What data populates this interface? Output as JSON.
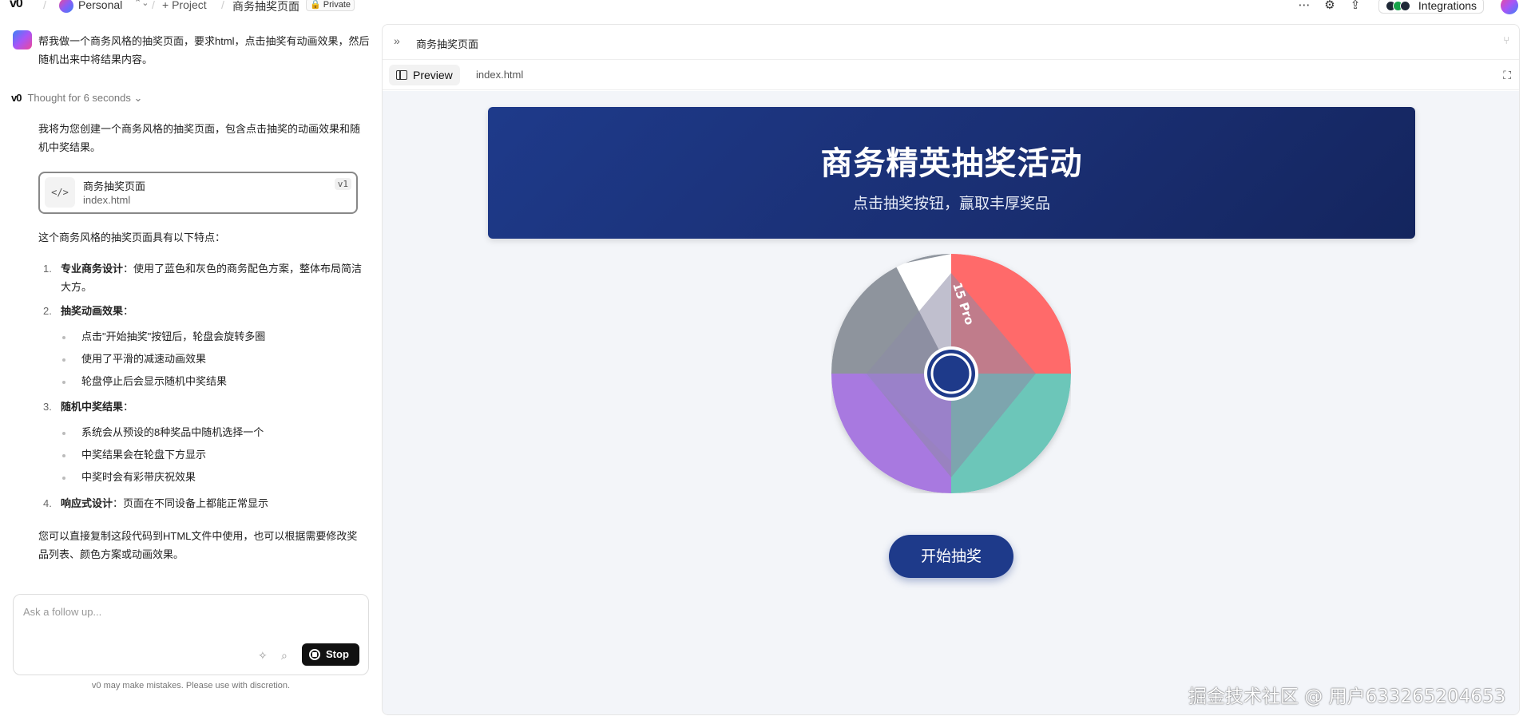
{
  "topbar": {
    "logo": "v0",
    "workspace": "Personal",
    "project_btn": "+ Project",
    "chat_title": "商务抽奖页面",
    "private_label": "Private",
    "integrations_label": "Integrations"
  },
  "chat": {
    "user_message": "帮我做一个商务风格的抽奖页面，要求html，点击抽奖有动画效果，然后随机出来中将结果内容。",
    "thought_label": "Thought for 6 seconds",
    "intro": "我将为您创建一个商务风格的抽奖页面，包含点击抽奖的动画效果和随机中奖结果。",
    "code_card": {
      "title": "商务抽奖页面",
      "file": "index.html",
      "version": "v1"
    },
    "features_intro": "这个商务风格的抽奖页面具有以下特点：",
    "features": [
      {
        "num": "1.",
        "title": "专业商务设计",
        "desc": "：使用了蓝色和灰色的商务配色方案，整体布局简洁大方。"
      },
      {
        "num": "2.",
        "title": "抽奖动画效果",
        "desc": "："
      },
      {
        "num": "3.",
        "title": "随机中奖结果",
        "desc": "："
      },
      {
        "num": "4.",
        "title": "响应式设计",
        "desc": "：页面在不同设备上都能正常显示"
      }
    ],
    "bullets_2": [
      "点击\"开始抽奖\"按钮后，轮盘会旋转多圈",
      "使用了平滑的减速动画效果",
      "轮盘停止后会显示随机中奖结果"
    ],
    "bullets_3": [
      "系统会从预设的8种奖品中随机选择一个",
      "中奖结果会在轮盘下方显示",
      "中奖时会有彩带庆祝效果"
    ],
    "closing": "您可以直接复制这段代码到HTML文件中使用，也可以根据需要修改奖品列表、颜色方案或动画效果。",
    "followup_placeholder": "Ask a follow up...",
    "stop_label": "Stop",
    "disclaimer": "v0 may make mistakes. Please use with discretion."
  },
  "preview": {
    "header_title": "商务抽奖页面",
    "tab_preview": "Preview",
    "tab_file": "index.html",
    "banner_title": "商务精英抽奖活动",
    "banner_subtitle": "点击抽奖按钮，赢取丰厚奖品",
    "wheel_label": "15 Pro",
    "start_button": "开始抽奖",
    "wheel_colors": [
      "#ff6b6b",
      "#6cc6b9",
      "#8d8aa6",
      "#a879e0",
      "#8e949d",
      "#ffffff"
    ],
    "accent": "#1e3a8a"
  },
  "watermark": "掘金技术社区 @ 用户633265204653"
}
